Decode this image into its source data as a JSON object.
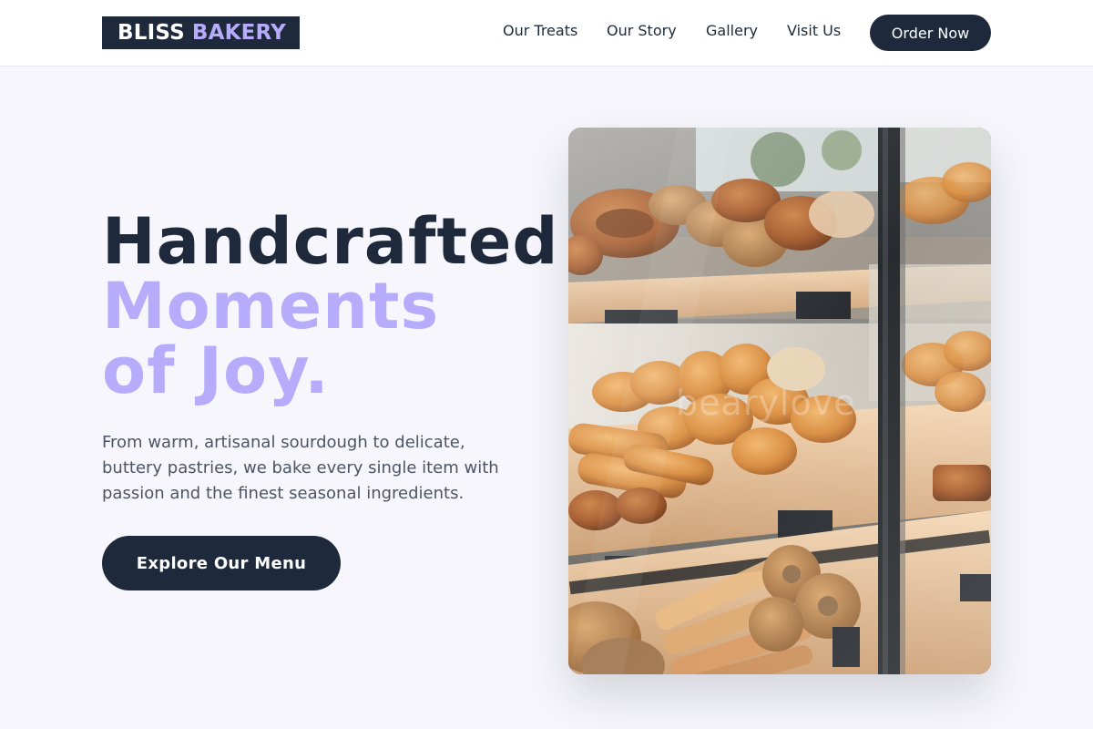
{
  "brand": {
    "name_part1": "BLISS",
    "name_part2": "BAKERY",
    "accent_color": "#b7acfb",
    "dark_color": "#1e293b"
  },
  "nav": {
    "links": [
      "Our Treats",
      "Our Story",
      "Gallery",
      "Visit Us"
    ],
    "cta_label": "Order Now"
  },
  "hero": {
    "title_line1": "Handcrafted",
    "title_line2": "Moments",
    "title_line3": "of Joy.",
    "description": "From warm, artisanal sourdough to delicate, buttery pastries, we bake every single item with passion and the finest seasonal ingredients.",
    "cta_label": "Explore Our Menu",
    "image_alt": "Bakery display case filled with pretzels, croissants, baguettes and bagels",
    "image_watermark": "bearylove"
  }
}
